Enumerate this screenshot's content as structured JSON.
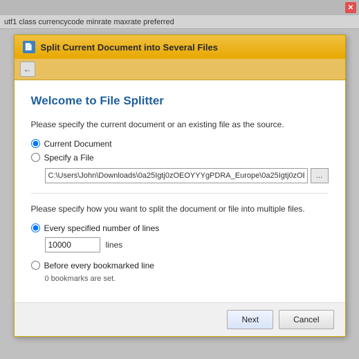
{
  "spreadsheet_header": {
    "columns": "utf1    class    currencycode    minrate  maxrate  preferred"
  },
  "dialog": {
    "title": "Split Current Document into Several Files",
    "icon_label": "F",
    "welcome_heading": "Welcome to File Splitter",
    "source_section_label": "Please specify the current document or an existing file as the source.",
    "radio_current_doc": "Current Document",
    "radio_specify_file": "Specify a File",
    "file_path_value": "C:\\Users\\John\\Downloads\\0a25Igtj0zOEOYYYgPDRA_Europe\\0a25Igtj0zOE",
    "browse_label": "...",
    "split_section_label": "Please specify how you want to split the document or file into multiple files.",
    "radio_every_lines": "Every specified number of lines",
    "lines_value": "10000",
    "lines_unit": "lines",
    "radio_bookmark": "Before every bookmarked line",
    "bookmark_note": "0 bookmarks are set.",
    "next_button": "Next",
    "cancel_button": "Cancel"
  },
  "colors": {
    "title_blue": "#2060a0",
    "close_red": "#e05050",
    "titlebar_gold": "#e8a800"
  }
}
